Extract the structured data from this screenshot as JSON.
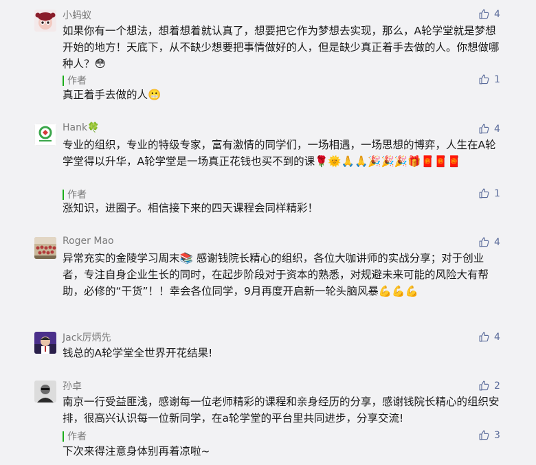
{
  "comments": [
    {
      "user": "小蚂蚁",
      "likes": "4",
      "text": "如果你有一个想法，想着想着就认真了，想要把它作为梦想去实现，那么，A轮学堂就是梦想开始的地方！天底下，从不缺少想要把事情做好的人，但是缺少真正着手去做的人。你想做哪种人？😳",
      "author_label": "作者",
      "reply_likes": "1",
      "reply_text": "真正着手去做的人😬"
    },
    {
      "user": "Hank🍀",
      "likes": "4",
      "text": "专业的组织，专业的特级专家，富有激情的同学们，一场相遇，一场思想的博弈，人生在A轮学堂得以升华，A轮学堂是一场真正花钱也买不到的课🌹🌞🙏🙏🎉🎉🎉🎁🧧🧧🧧",
      "author_label": "作者",
      "reply_likes": "1",
      "reply_text": "涨知识，进圈子。相信接下来的四天课程会同样精彩！"
    },
    {
      "user": "Roger Mao",
      "likes": "4",
      "text": "异常充实的金陵学习周末📚 感谢钱院长精心的组织，各位大咖讲师的实战分享；对于创业者，专注自身企业生长的同时，在起步阶段对于资本的熟悉，对规避未来可能的风险大有帮助，必修的“干货”！！幸会各位同学，9月再度开启新一轮头脑风暴💪💪💪"
    },
    {
      "user": "Jack厉炳先",
      "likes": "4",
      "text": "钱总的A轮学堂全世界开花结果!"
    },
    {
      "user": "孙卓",
      "likes": "2",
      "text": "南京一行受益匪浅，感谢每一位老师精彩的课程和亲身经历的分享，感谢钱院长精心的组织安排，很高兴认识每一位新同学，在a轮学堂的平台里共同进步，分享交流!",
      "author_label": "作者",
      "reply_likes": "3",
      "reply_text": "下次来得注意身体别再着凉啦~"
    }
  ],
  "colors": {
    "like_blue": "#5a6b9a",
    "author_green": "#1aad19",
    "background": "#f2f2f4"
  },
  "icons": {
    "like": "thumbs-up-outline-icon"
  }
}
